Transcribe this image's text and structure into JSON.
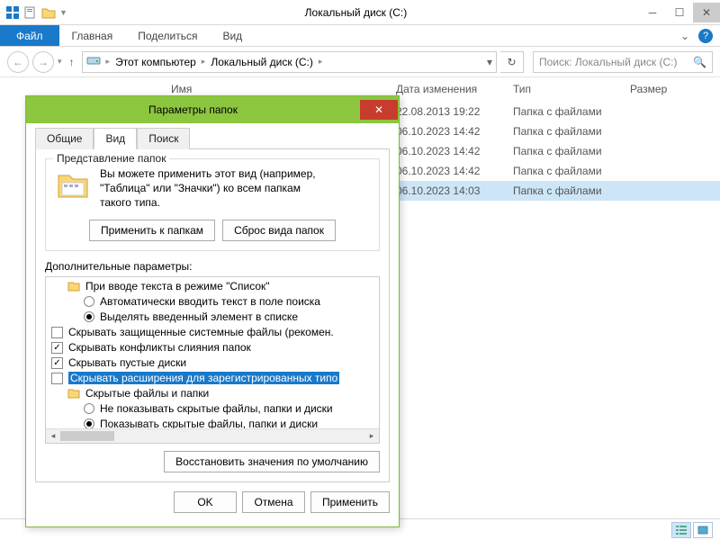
{
  "titlebar": {
    "title": "Локальный диск (C:)"
  },
  "ribbon": {
    "file": "Файл",
    "home": "Главная",
    "share": "Поделиться",
    "view": "Вид"
  },
  "addr": {
    "crumb1": "Этот компьютер",
    "crumb2": "Локальный диск (C:)"
  },
  "search": {
    "placeholder": "Поиск: Локальный диск (C:)"
  },
  "columns": {
    "name": "Имя",
    "date": "Дата изменения",
    "type": "Тип",
    "size": "Размер"
  },
  "rows": [
    {
      "date": "22.08.2013 19:22",
      "type": "Папка с файлами"
    },
    {
      "date": "06.10.2023 14:42",
      "type": "Папка с файлами"
    },
    {
      "date": "06.10.2023 14:42",
      "type": "Папка с файлами"
    },
    {
      "date": "06.10.2023 14:42",
      "type": "Папка с файлами"
    },
    {
      "date": "06.10.2023 14:03",
      "type": "Папка с файлами"
    }
  ],
  "dialog": {
    "title": "Параметры папок",
    "tabs": {
      "general": "Общие",
      "view": "Вид",
      "search": "Поиск"
    },
    "group_title": "Представление папок",
    "group_text1": "Вы можете применить этот вид (например,",
    "group_text2": "\"Таблица\" или \"Значки\") ко всем папкам",
    "group_text3": "такого типа.",
    "apply_folders": "Применить к папкам",
    "reset_folders": "Сброс вида папок",
    "adv_label": "Дополнительные параметры:",
    "tree": {
      "l1": "При вводе текста в режиме \"Список\"",
      "l2": "Автоматически вводить текст в поле поиска",
      "l3": "Выделять введенный элемент в списке",
      "l4": "Скрывать защищенные системные файлы (рекомен.",
      "l5": "Скрывать конфликты слияния папок",
      "l6": "Скрывать пустые диски",
      "l7": "Скрывать расширения для зарегистрированных типо",
      "l8": "Скрытые файлы и папки",
      "l9": "Не показывать скрытые файлы, папки и диски",
      "l10": "Показывать скрытые файлы, папки и диски"
    },
    "restore": "Восстановить значения по умолчанию",
    "ok": "OK",
    "cancel": "Отмена",
    "apply": "Применить"
  }
}
